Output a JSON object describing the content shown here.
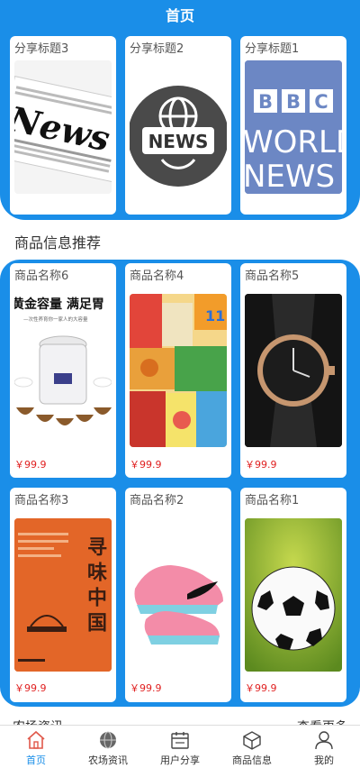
{
  "header": {
    "title": "首页"
  },
  "share": {
    "items": [
      {
        "title": "分享标题3",
        "image": "newspaper-image"
      },
      {
        "title": "分享标题2",
        "image": "news-globe-image"
      },
      {
        "title": "分享标题1",
        "image": "bbc-world-news-image"
      }
    ]
  },
  "goods": {
    "section_title": "商品信息推荐",
    "items": [
      {
        "title": "商品名称6",
        "price": "￥99.9",
        "image": "rice-cooker-image",
        "image_text": "黄金容量 满足胃",
        "image_subtext": "—次性养育你一家人的大容量"
      },
      {
        "title": "商品名称4",
        "price": "￥99.9",
        "image": "snacks-image",
        "image_text": "11"
      },
      {
        "title": "商品名称5",
        "price": "￥99.9",
        "image": "wristwatch-image"
      },
      {
        "title": "商品名称3",
        "price": "￥99.9",
        "image": "book-cover-image",
        "image_text": "寻味中国"
      },
      {
        "title": "商品名称2",
        "price": "￥99.9",
        "image": "pink-sneaker-image"
      },
      {
        "title": "商品名称1",
        "price": "￥99.9",
        "image": "soccer-ball-image"
      }
    ]
  },
  "news": {
    "title": "农场资讯",
    "more": "查看更多"
  },
  "tabbar": {
    "items": [
      {
        "label": "首页",
        "icon": "home-icon",
        "active": true
      },
      {
        "label": "农场资讯",
        "icon": "globe-icon",
        "active": false
      },
      {
        "label": "用户分享",
        "icon": "calendar-icon",
        "active": false
      },
      {
        "label": "商品信息",
        "icon": "box-icon",
        "active": false
      },
      {
        "label": "我的",
        "icon": "user-icon",
        "active": false
      }
    ]
  },
  "colors": {
    "primary": "#1a8ee8",
    "price": "#e02020"
  }
}
